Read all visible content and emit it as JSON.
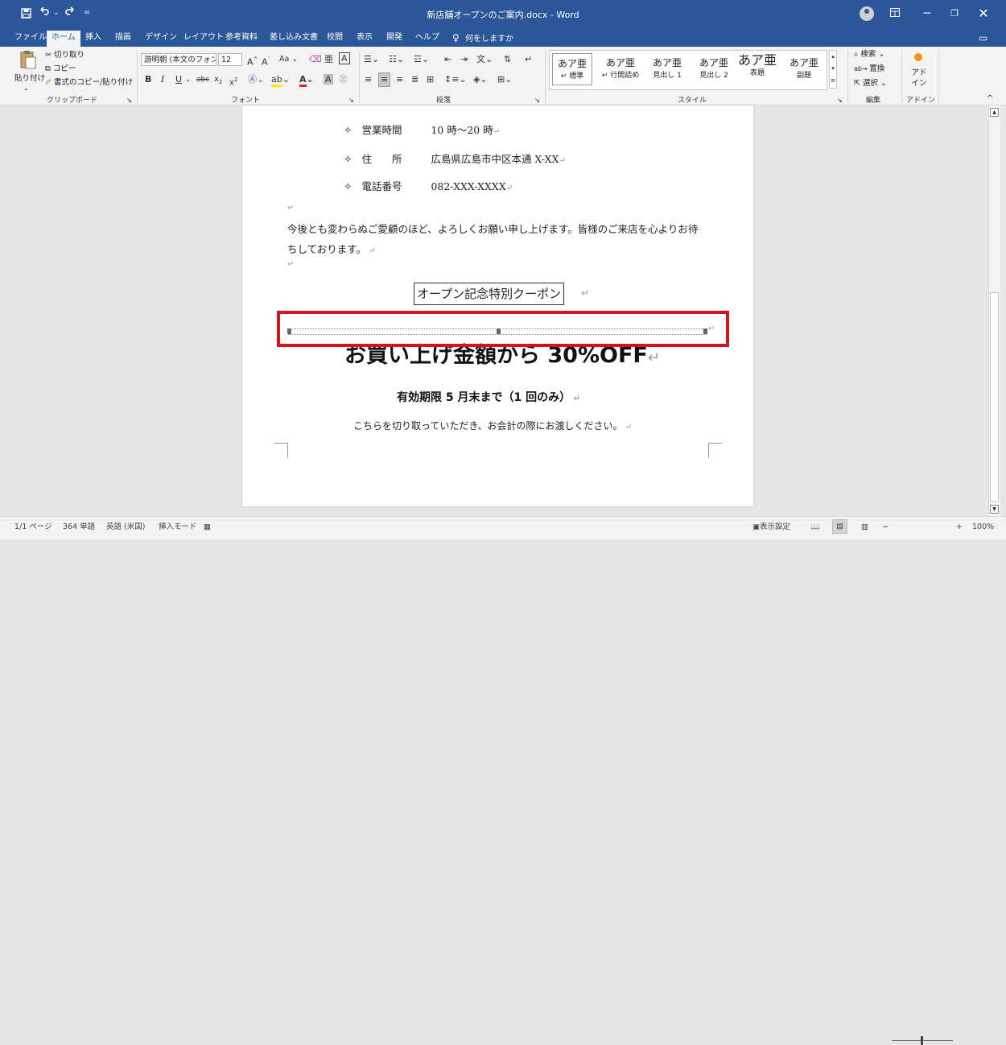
{
  "titlebar": {
    "title": "新店舗オープンのご案内.docx  -  Word",
    "save_icon": "save-icon",
    "undo_icon": "undo-icon",
    "redo_icon": "redo-icon",
    "customize": "="
  },
  "tabs": [
    {
      "label": "ファイル"
    },
    {
      "label": "ホーム"
    },
    {
      "label": "挿入"
    },
    {
      "label": "描画"
    },
    {
      "label": "デザイン"
    },
    {
      "label": "レイアウト"
    },
    {
      "label": "参考資料"
    },
    {
      "label": "差し込み文書"
    },
    {
      "label": "校閲"
    },
    {
      "label": "表示"
    },
    {
      "label": "開発"
    },
    {
      "label": "ヘルプ"
    }
  ],
  "tell_me": "何をしますか",
  "ribbon": {
    "clipboard": {
      "paste": "貼り付け",
      "cut": "切り取り",
      "copy": "コピー",
      "format_painter": "書式のコピー/貼り付け",
      "label": "クリップボード"
    },
    "font": {
      "name": "游明朝 (本文のフォン",
      "size": "12",
      "label": "フォント"
    },
    "paragraph": {
      "label": "段落"
    },
    "styles": {
      "label": "スタイル",
      "items": [
        {
          "sample": "あア亜",
          "name": "↵ 標準"
        },
        {
          "sample": "あア亜",
          "name": "↵ 行間詰め"
        },
        {
          "sample": "あア亜",
          "name": "見出し 1"
        },
        {
          "sample": "あア亜",
          "name": "見出し 2"
        },
        {
          "sample": "あア亜",
          "name": "表題"
        },
        {
          "sample": "あア亜",
          "name": "副題"
        }
      ]
    },
    "editing": {
      "find": "検索",
      "replace": "置換",
      "select": "選択",
      "label": "編集"
    },
    "addins": {
      "button": "アド\nイン",
      "label": "アドイン"
    }
  },
  "document": {
    "info_rows": [
      {
        "bullet": "✧",
        "label": "営業時間",
        "value": "10 時～20 時"
      },
      {
        "bullet": "✧",
        "label": "住　　所",
        "value": "広島県広島市中区本通 X-XX"
      },
      {
        "bullet": "✧",
        "label": "電話番号",
        "value": "082-XXX-XXXX"
      }
    ],
    "closing_line1": "今後とも変わらぬご愛顧のほど、よろしくお願い申し上げます。皆様のご来店を心よりお待",
    "closing_line2": "ちしております。",
    "coupon_title": "オープン記念特別クーポン",
    "coupon_headline": "お買い上げ金額から 30%OFF",
    "validity": "有効期限 5 月末まで（1 回のみ）",
    "instruction": "こちらを切り取っていただき、お会計の際にお渡しください。",
    "highlight_color": "#d0161d"
  },
  "statusbar": {
    "page": "1/1 ページ",
    "words": "364 単語",
    "language": "英語 (米国)",
    "mode": "挿入モード",
    "display_settings": "表示設定",
    "zoom": "100%",
    "zoom_level": 1.0
  },
  "colors": {
    "word_blue": "#2b579a",
    "ribbon_bg": "#f3f3f3",
    "canvas_bg": "#e6e6e6"
  }
}
